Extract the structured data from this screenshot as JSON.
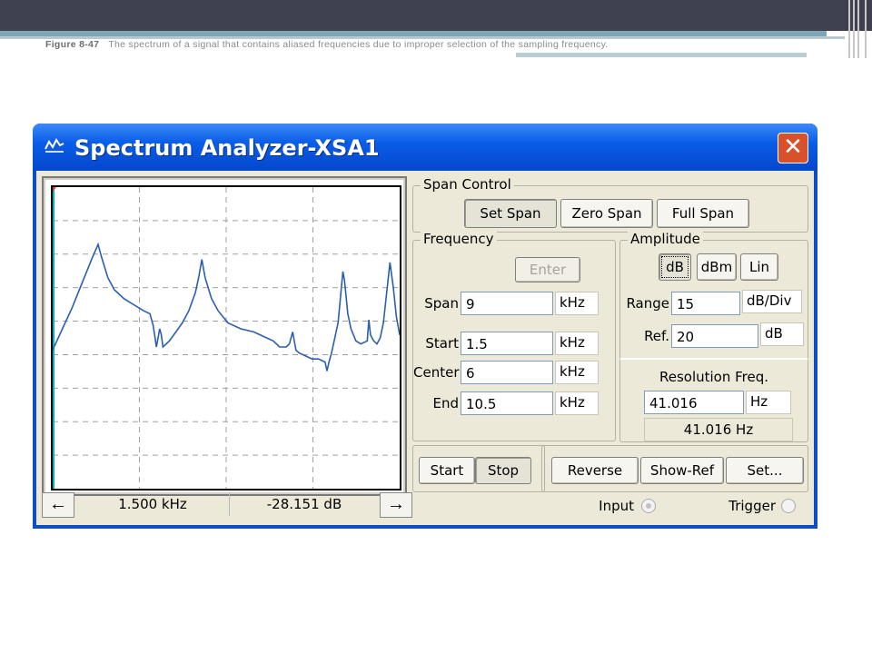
{
  "slide": {
    "figure_label": "Figure 8-47",
    "caption": "The spectrum of a signal that contains aliased frequencies due to improper selection of the sampling frequency."
  },
  "window": {
    "title": "Spectrum Analyzer-XSA1",
    "close_label": "✕",
    "title_color": "#0a5de8"
  },
  "display": {
    "trace_color": "#2a5fb0",
    "cursor_color": "#00b4b4",
    "marker_color": "#e04020",
    "grid_color": "#a0a0a0",
    "trace": [
      [
        0,
        0.54
      ],
      [
        3,
        0.47
      ],
      [
        6,
        0.4
      ],
      [
        9,
        0.32
      ],
      [
        12,
        0.24
      ],
      [
        14,
        0.19
      ],
      [
        15,
        0.23
      ],
      [
        17,
        0.3
      ],
      [
        19,
        0.34
      ],
      [
        22,
        0.37
      ],
      [
        25,
        0.39
      ],
      [
        28,
        0.41
      ],
      [
        30,
        0.42
      ],
      [
        31,
        0.46
      ],
      [
        32,
        0.53
      ],
      [
        33,
        0.47
      ],
      [
        33.5,
        0.49
      ],
      [
        34,
        0.53
      ],
      [
        36,
        0.51
      ],
      [
        38,
        0.48
      ],
      [
        40,
        0.45
      ],
      [
        42,
        0.41
      ],
      [
        44,
        0.35
      ],
      [
        45,
        0.3
      ],
      [
        46,
        0.24
      ],
      [
        47,
        0.3
      ],
      [
        49,
        0.37
      ],
      [
        51,
        0.41
      ],
      [
        54,
        0.45
      ],
      [
        58,
        0.47
      ],
      [
        62,
        0.48
      ],
      [
        66,
        0.5
      ],
      [
        68,
        0.51
      ],
      [
        70,
        0.53
      ],
      [
        72,
        0.53
      ],
      [
        73,
        0.52
      ],
      [
        74,
        0.48
      ],
      [
        75,
        0.54
      ],
      [
        76,
        0.55
      ],
      [
        78,
        0.56
      ],
      [
        80,
        0.57
      ],
      [
        82,
        0.57
      ],
      [
        84,
        0.58
      ],
      [
        84.6,
        0.61
      ],
      [
        85.2,
        0.58
      ],
      [
        86,
        0.55
      ],
      [
        88,
        0.45
      ],
      [
        89.5,
        0.28
      ],
      [
        90,
        0.31
      ],
      [
        91,
        0.42
      ],
      [
        92,
        0.47
      ],
      [
        93.5,
        0.51
      ],
      [
        95,
        0.52
      ],
      [
        97,
        0.51
      ],
      [
        97.5,
        0.44
      ],
      [
        98,
        0.49
      ],
      [
        99,
        0.51
      ],
      [
        100,
        0.52
      ],
      [
        101,
        0.5
      ],
      [
        102,
        0.45
      ],
      [
        103,
        0.35
      ],
      [
        104,
        0.25
      ],
      [
        105,
        0.33
      ],
      [
        106,
        0.43
      ],
      [
        107,
        0.49
      ]
    ]
  },
  "status": {
    "left_arrow": "←",
    "right_arrow": "→",
    "frequency": "1.500  kHz",
    "level": "-28.151  dB"
  },
  "span_control": {
    "label": "Span Control",
    "set_span": "Set Span",
    "zero_span": "Zero Span",
    "full_span": "Full Span"
  },
  "frequency": {
    "label": "Frequency",
    "enter": "Enter",
    "span_label": "Span",
    "span_value": "9",
    "span_unit": "kHz",
    "start_label": "Start",
    "start_value": "1.5",
    "start_unit": "kHz",
    "center_label": "Center",
    "center_value": "6",
    "center_unit": "kHz",
    "end_label": "End",
    "end_value": "10.5",
    "end_unit": "kHz"
  },
  "amplitude": {
    "label": "Amplitude",
    "db": "dB",
    "dbm": "dBm",
    "lin": "Lin",
    "range_label": "Range",
    "range_value": "15",
    "range_unit": "dB/Div",
    "ref_label": "Ref.",
    "ref_value": "20",
    "ref_unit": "dB"
  },
  "resolution": {
    "label": "Resolution Freq.",
    "value": "41.016",
    "unit": "Hz",
    "readout": "41.016  Hz"
  },
  "controls": {
    "start": "Start",
    "stop": "Stop",
    "reverse": "Reverse",
    "show_ref": "Show-Ref",
    "set": "Set...",
    "input_label": "Input",
    "trigger_label": "Trigger"
  }
}
